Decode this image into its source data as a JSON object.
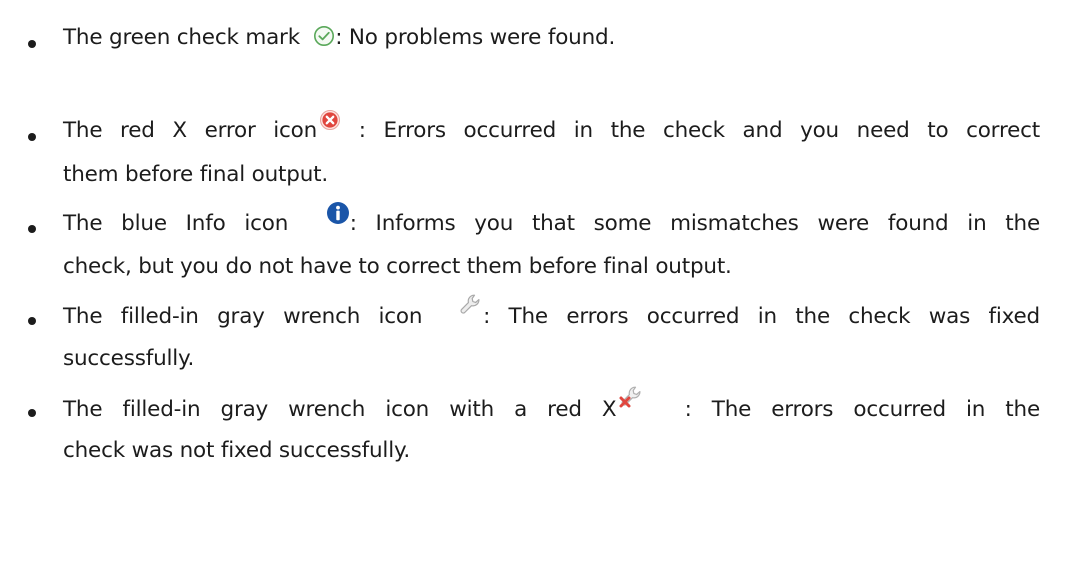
{
  "items": [
    {
      "icon": "green-check-circle-icon",
      "color": "#5aa85a",
      "before": "The green check mark",
      "after": ": No problems were found.",
      "cont": ""
    },
    {
      "icon": "red-x-error-icon",
      "color": "#e0463e",
      "before": "The red X error icon",
      "after": ": Errors occurred in the check and you need to correct",
      "cont": "them before final output."
    },
    {
      "icon": "blue-info-icon",
      "color": "#1a55a8",
      "before": "The blue Info icon",
      "after": ": Informs you that some mismatches were found in the",
      "cont": "check, but you do not have to correct them before final output."
    },
    {
      "icon": "gray-wrench-icon",
      "color": "#b3b3b3",
      "before": "The filled-in gray wrench icon",
      "after": ": The errors occurred in the check was fixed",
      "cont": "successfully."
    },
    {
      "icon": "gray-wrench-red-x-icon",
      "color": "#c9c9c9",
      "before": "The filled-in gray wrench icon with a red X",
      "after": ": The errors occurred in the",
      "cont": "check was not fixed successfully."
    }
  ]
}
